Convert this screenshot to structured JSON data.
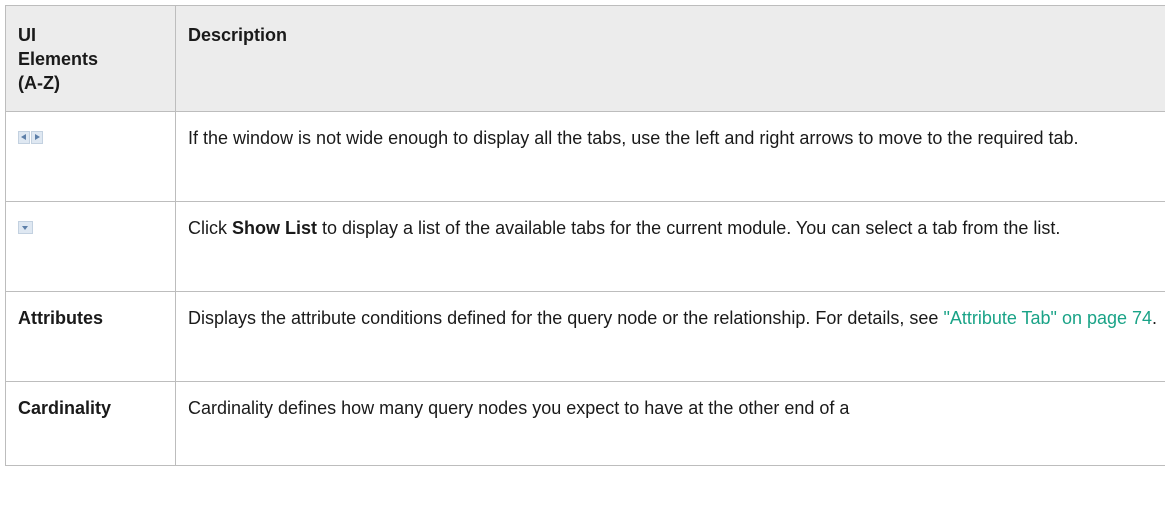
{
  "header": {
    "col1": "UI Elements (A-Z)",
    "col1_line1": "UI",
    "col1_line2": "Elements",
    "col1_line3": "(A-Z)",
    "col2": "Description"
  },
  "rows": [
    {
      "icon": "left-right-arrows-icon",
      "description": "If the window is not wide enough to display all the tabs, use the left and right arrows to move to the required tab."
    },
    {
      "icon": "show-list-dropdown-icon",
      "description_pre": "Click ",
      "description_bold": "Show List",
      "description_post": " to display a list of the available tabs for the current module. You can select a tab from the list."
    },
    {
      "element": "Attributes",
      "description_pre": "Displays the attribute conditions defined for the query node or the relationship. For details, see ",
      "link": "\"Attribute Tab\" on page 74",
      "description_post": "."
    },
    {
      "element": "Cardinality",
      "description": "Cardinality defines how many query nodes you expect to have at the other end of a"
    }
  ],
  "colors": {
    "link": "#1aa387",
    "header_bg": "#ececec",
    "border": "#bdbdbd"
  }
}
